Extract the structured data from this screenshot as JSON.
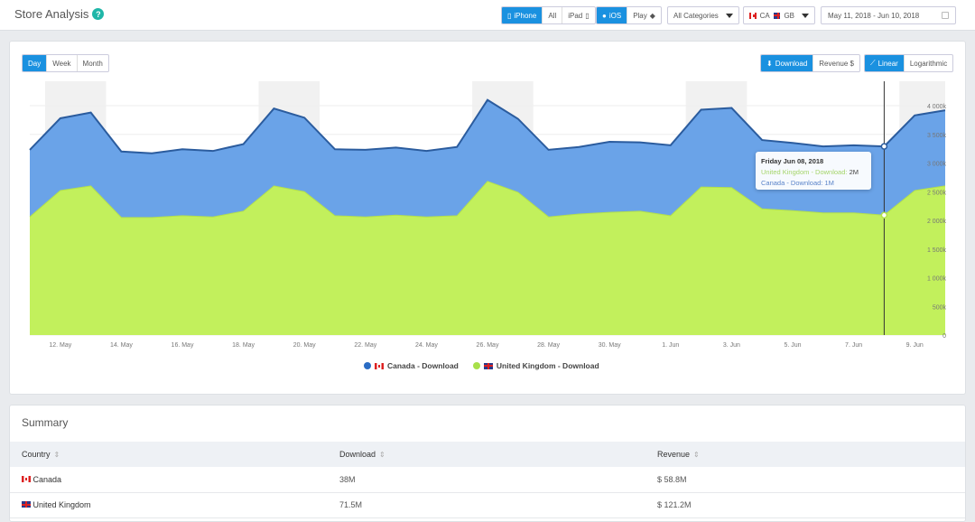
{
  "header": {
    "title": "Store Analysis",
    "help_icon": "?",
    "device_buttons": [
      {
        "label": "iPhone",
        "icon": "phone-icon",
        "active": true
      },
      {
        "label": "All",
        "active": false
      },
      {
        "label": "iPad",
        "icon": "tablet-icon",
        "active": false
      }
    ],
    "store_buttons": [
      {
        "label": "iOS",
        "icon": "apple-icon",
        "active": true
      },
      {
        "label": "Play",
        "icon": "android-icon",
        "active": false
      }
    ],
    "category_select": "All Categories",
    "country_select": {
      "items": [
        "CA",
        "GB"
      ]
    },
    "date_range": "May 11, 2018 - Jun 10, 2018"
  },
  "chart_controls": {
    "period": [
      {
        "label": "Day",
        "active": true
      },
      {
        "label": "Week",
        "active": false
      },
      {
        "label": "Month",
        "active": false
      }
    ],
    "metric": [
      {
        "label": "Download",
        "icon": "download-icon",
        "active": true
      },
      {
        "label": "Revenue $",
        "active": false
      }
    ],
    "scale": [
      {
        "label": "Linear",
        "icon": "line-chart-icon",
        "active": true
      },
      {
        "label": "Logarithmic",
        "active": false
      }
    ]
  },
  "tooltip": {
    "date": "Friday Jun 08, 2018",
    "uk_label": "United Kingdom - Download:",
    "uk_value": "2M",
    "ca_label": "Canada - Download:",
    "ca_value": "1M"
  },
  "chart_data": {
    "type": "area",
    "stacked": true,
    "title": "",
    "xlabel": "",
    "ylabel": "",
    "x": [
      "May 11",
      "May 12",
      "May 13",
      "May 14",
      "May 15",
      "May 16",
      "May 17",
      "May 18",
      "May 19",
      "May 20",
      "May 21",
      "May 22",
      "May 23",
      "May 24",
      "May 25",
      "May 26",
      "May 27",
      "May 28",
      "May 29",
      "May 30",
      "May 31",
      "Jun 1",
      "Jun 2",
      "Jun 3",
      "Jun 4",
      "Jun 5",
      "Jun 6",
      "Jun 7",
      "Jun 8",
      "Jun 9",
      "Jun 10"
    ],
    "x_tick_labels": [
      "12. May",
      "14. May",
      "16. May",
      "18. May",
      "20. May",
      "22. May",
      "24. May",
      "26. May",
      "28. May",
      "30. May",
      "1. Jun",
      "3. Jun",
      "5. Jun",
      "7. Jun",
      "9. Jun"
    ],
    "y_tick_labels": [
      "0",
      "500k",
      "1 000k",
      "1 500k",
      "2 000k",
      "2 500k",
      "3 000k",
      "3 500k",
      "4 000k"
    ],
    "ylim": [
      0,
      4500000
    ],
    "grid": true,
    "legend_position": "bottom-center",
    "series": [
      {
        "name": "United Kingdom - Download",
        "color": "#c2f05c",
        "line_color": "#b3e04c",
        "values": [
          2060000,
          2520000,
          2600000,
          2050000,
          2050000,
          2080000,
          2060000,
          2160000,
          2600000,
          2500000,
          2080000,
          2060000,
          2090000,
          2060000,
          2080000,
          2680000,
          2490000,
          2060000,
          2110000,
          2140000,
          2160000,
          2080000,
          2580000,
          2570000,
          2200000,
          2170000,
          2130000,
          2130000,
          2090000,
          2520000,
          2600000
        ]
      },
      {
        "name": "Canada - Download",
        "color": "#6aa3e8",
        "line_color": "#2b5c9e",
        "values": [
          1170000,
          1260000,
          1280000,
          1150000,
          1120000,
          1160000,
          1150000,
          1170000,
          1350000,
          1290000,
          1160000,
          1170000,
          1180000,
          1150000,
          1200000,
          1420000,
          1280000,
          1170000,
          1170000,
          1230000,
          1200000,
          1230000,
          1350000,
          1390000,
          1200000,
          1180000,
          1160000,
          1180000,
          1200000,
          1310000,
          1320000
        ]
      }
    ],
    "hover_index": 28,
    "weekend_bands": [
      "May 12-13",
      "May 19-20",
      "May 26-27",
      "Jun 2-3",
      "Jun 9-10"
    ]
  },
  "legend": [
    {
      "label": "Canada - Download",
      "color": "#2b6cc4",
      "flag": "CA"
    },
    {
      "label": "United Kingdom - Download",
      "color": "#a8e04a",
      "flag": "GB"
    }
  ],
  "summary": {
    "title": "Summary",
    "columns": [
      "Country",
      "Download",
      "Revenue"
    ],
    "rows": [
      {
        "country": "Canada",
        "flag": "CA",
        "download": "38M",
        "revenue": "$ 58.8M"
      },
      {
        "country": "United Kingdom",
        "flag": "GB",
        "download": "71.5M",
        "revenue": "$ 121.2M"
      }
    ]
  }
}
